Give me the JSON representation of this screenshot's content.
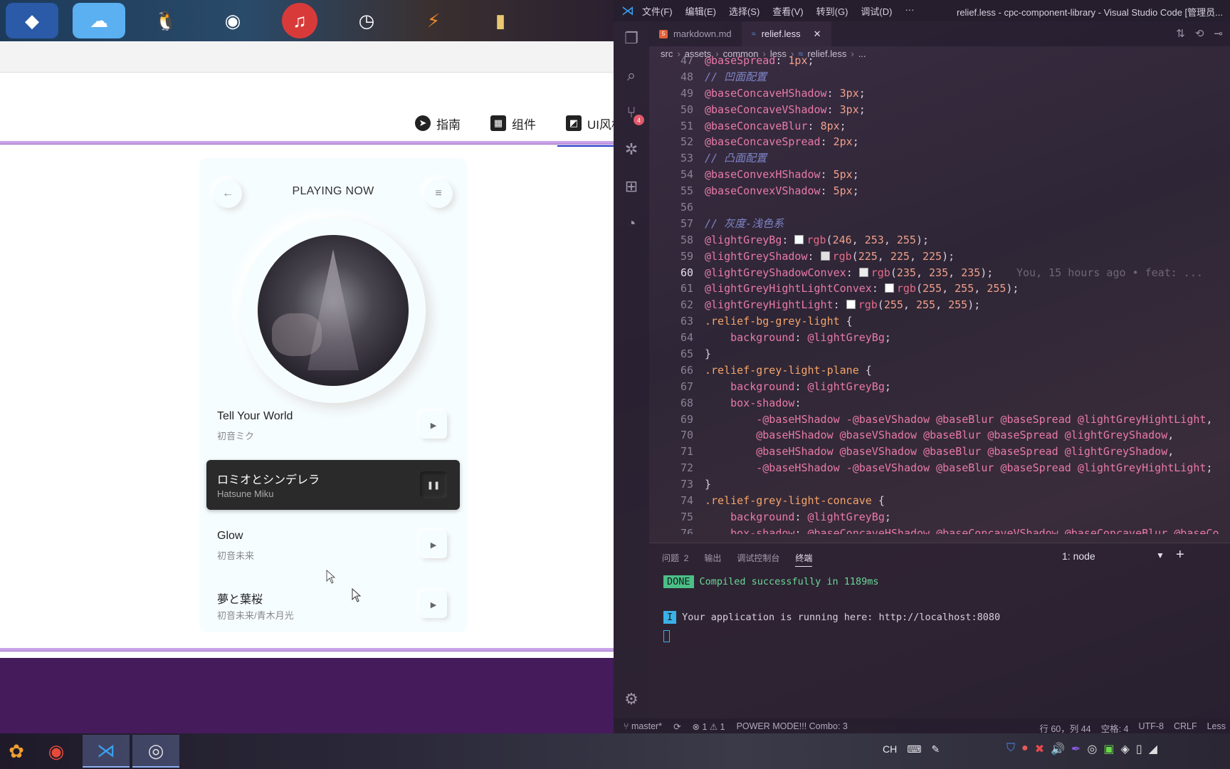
{
  "browser": {
    "nav": [
      {
        "label": "指南",
        "icon": "compass-icon"
      },
      {
        "label": "组件",
        "icon": "components-icon"
      },
      {
        "label": "UI风格",
        "icon": "ui-style-icon"
      }
    ],
    "player": {
      "title": "PLAYING NOW",
      "back_icon": "←",
      "menu_icon": "≡",
      "songs": [
        {
          "name": "Tell Your World",
          "artist": "初音ミク",
          "button": "▶",
          "active": false
        },
        {
          "name": "ロミオとシンデレラ",
          "artist": "Hatsune Miku",
          "button": "❚❚",
          "active": true
        },
        {
          "name": "Glow",
          "artist": "初音未来",
          "button": "▶",
          "active": false
        },
        {
          "name": "夢と葉桜",
          "artist": "初音未来/青木月光",
          "button": "▶",
          "active": false
        }
      ]
    }
  },
  "vscode": {
    "menu": [
      "文件(F)",
      "编辑(E)",
      "选择(S)",
      "查看(V)",
      "转到(G)",
      "调试(D)",
      "···"
    ],
    "window_title": "relief.less - cpc-component-library - Visual Studio Code [管理员...",
    "scm_badge": "4",
    "tabs": [
      {
        "label": "markdown.md",
        "active": false
      },
      {
        "label": "relief.less",
        "active": true,
        "close": "✕"
      }
    ],
    "breadcrumb": [
      "src",
      "assets",
      "common",
      "less",
      "relief.less",
      "..."
    ],
    "blame": "You, 15 hours ago • feat: ...",
    "lines": [
      {
        "n": "47",
        "code": "@baseSpread: 1px;"
      },
      {
        "n": "48",
        "code": "// 凹面配置"
      },
      {
        "n": "49",
        "code": "@baseConcaveHShadow: 3px;"
      },
      {
        "n": "50",
        "code": "@baseConcaveVShadow: 3px;"
      },
      {
        "n": "51",
        "code": "@baseConcaveBlur: 8px;"
      },
      {
        "n": "52",
        "code": "@baseConcaveSpread: 2px;"
      },
      {
        "n": "53",
        "code": "// 凸面配置"
      },
      {
        "n": "54",
        "code": "@baseConvexHShadow: 5px;"
      },
      {
        "n": "55",
        "code": "@baseConvexVShadow: 5px;"
      },
      {
        "n": "56",
        "code": ""
      },
      {
        "n": "57",
        "code": "// 灰度-浅色系"
      },
      {
        "n": "58",
        "code": "@lightGreyBg: rgb(246, 253, 255);"
      },
      {
        "n": "59",
        "code": "@lightGreyShadow: rgb(225, 225, 225);"
      },
      {
        "n": "60",
        "code": "@lightGreyShadowConvex: rgb(235, 235, 235);"
      },
      {
        "n": "61",
        "code": "@lightGreyHightLightConvex: rgb(255, 255, 255);"
      },
      {
        "n": "62",
        "code": "@lightGreyHightLight: rgb(255, 255, 255);"
      },
      {
        "n": "63",
        "code": ".relief-bg-grey-light {"
      },
      {
        "n": "64",
        "code": "    background: @lightGreyBg;"
      },
      {
        "n": "65",
        "code": "}"
      },
      {
        "n": "66",
        "code": ".relief-grey-light-plane {"
      },
      {
        "n": "67",
        "code": "    background: @lightGreyBg;"
      },
      {
        "n": "68",
        "code": "    box-shadow:"
      },
      {
        "n": "69",
        "code": "        -@baseHShadow -@baseVShadow @baseBlur @baseSpread @lightGreyHightLight,"
      },
      {
        "n": "70",
        "code": "        @baseHShadow @baseVShadow @baseBlur @baseSpread @lightGreyShadow,"
      },
      {
        "n": "71",
        "code": "        @baseHShadow @baseVShadow @baseBlur @baseSpread @lightGreyShadow,"
      },
      {
        "n": "72",
        "code": "        -@baseHShadow -@baseVShadow @baseBlur @baseSpread @lightGreyHightLight;"
      },
      {
        "n": "73",
        "code": "}"
      },
      {
        "n": "74",
        "code": ".relief-grey-light-concave {"
      },
      {
        "n": "75",
        "code": "    background: @lightGreyBg;"
      },
      {
        "n": "76",
        "code": "    box-shadow: @baseConcaveHShadow @baseConcaveVShadow @baseConcaveBlur @baseCo"
      }
    ],
    "panel": {
      "tabs": [
        {
          "label": "问题",
          "count": "2"
        },
        {
          "label": "输出"
        },
        {
          "label": "调试控制台"
        },
        {
          "label": "终端",
          "active": true
        }
      ],
      "terminal_select": "1: node",
      "done_tag": "DONE",
      "done_msg": "Compiled successfully in 1189ms",
      "info_tag": "I",
      "info_msg": "Your application is running here: http://localhost:8080"
    },
    "status": {
      "branch": "master*",
      "problems": "⊗ 1 ⚠ 1",
      "power_mode": "POWER MODE!!! Combo: 3",
      "position": "行 60，列 44",
      "spaces": "空格: 4",
      "encoding": "UTF-8",
      "eol": "CRLF",
      "language": "Less"
    }
  },
  "taskbar": {
    "ime": "CH"
  }
}
